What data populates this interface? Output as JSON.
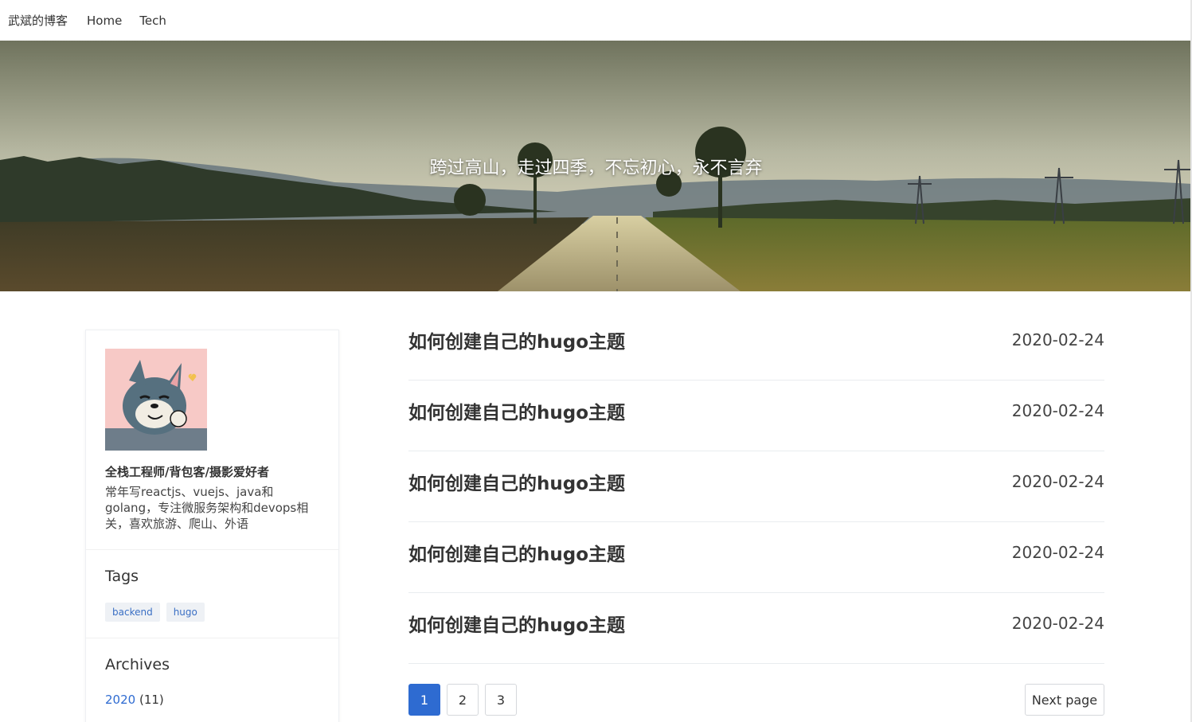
{
  "nav": {
    "brand": "武斌的博客",
    "links": [
      "Home",
      "Tech"
    ]
  },
  "hero": {
    "motto": "跨过高山，走过四季，不忘初心，永不言弃"
  },
  "profile": {
    "title": "全栈工程师/背包客/摄影爱好者",
    "description": "常年写reactjs、vuejs、java和golang，专注微服务架构和devops相关，喜欢旅游、爬山、外语"
  },
  "tags": {
    "heading": "Tags",
    "items": [
      "backend",
      "hugo"
    ]
  },
  "archives": {
    "heading": "Archives",
    "items": [
      {
        "year": "2020",
        "count": "(11)"
      }
    ]
  },
  "posts": [
    {
      "title": "如何创建自己的hugo主题",
      "date": "2020-02-24"
    },
    {
      "title": "如何创建自己的hugo主题",
      "date": "2020-02-24"
    },
    {
      "title": "如何创建自己的hugo主题",
      "date": "2020-02-24"
    },
    {
      "title": "如何创建自己的hugo主题",
      "date": "2020-02-24"
    },
    {
      "title": "如何创建自己的hugo主题",
      "date": "2020-02-24"
    }
  ],
  "pagination": {
    "pages": [
      "1",
      "2",
      "3"
    ],
    "current": "1",
    "next_label": "Next page"
  },
  "colors": {
    "accent": "#2e6bd1",
    "tag_bg": "#eef1f5"
  }
}
